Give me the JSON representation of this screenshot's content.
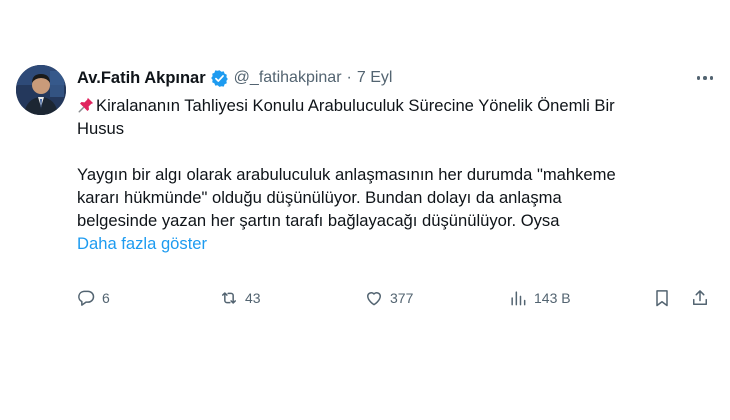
{
  "author": {
    "name": "Av.Fatih Akpınar",
    "handle": "@_fatihakpinar",
    "separator": "·",
    "date": "7 Eyl"
  },
  "tweet": {
    "lines": [
      "Kiralananın Tahliyesi Konulu Arabuluculuk Sürecine Yönelik Önemli Bir",
      "Husus",
      "Yaygın bir algı olarak arabuluculuk anlaşmasının her durumda \"mahkeme",
      "kararı hükmünde\" olduğu düşünülüyor. Bundan dolayı da anlaşma",
      "belgesinde yazan her şartın tarafı bağlayacağı düşünülüyor. Oysa"
    ],
    "show_more": "Daha fazla göster"
  },
  "actions": {
    "replies": "6",
    "retweets": "43",
    "likes": "377",
    "views": "143 B"
  },
  "colors": {
    "text": "#0f1419",
    "secondary": "#536471",
    "link": "#1d9bf0",
    "verified": "#1d9bf0"
  },
  "icons": [
    "pushpin-icon",
    "verified-badge-icon",
    "more-options-icon",
    "reply-icon",
    "retweet-icon",
    "like-icon",
    "views-icon",
    "bookmark-icon",
    "share-icon"
  ]
}
